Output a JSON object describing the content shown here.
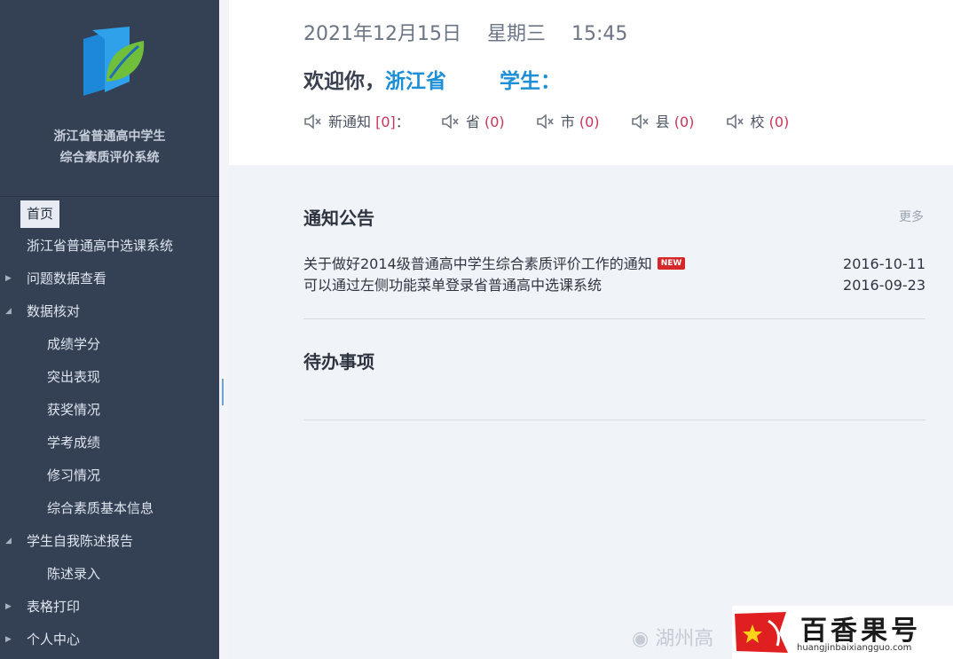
{
  "brand": {
    "title_line1": "浙江省普通高中学生",
    "title_line2": "综合素质评价系统"
  },
  "nav": {
    "items": [
      {
        "label": "首页"
      },
      {
        "label": "浙江省普通高中选课系统"
      },
      {
        "label": "问题数据查看",
        "expander": "collapsed"
      },
      {
        "label": "数据核对",
        "expander": "expanded"
      },
      {
        "label": "成绩学分"
      },
      {
        "label": "突出表现"
      },
      {
        "label": "获奖情况"
      },
      {
        "label": "学考成绩"
      },
      {
        "label": "修习情况"
      },
      {
        "label": "综合素质基本信息"
      },
      {
        "label": "学生自我陈述报告",
        "expander": "expanded"
      },
      {
        "label": "陈述录入"
      },
      {
        "label": "表格打印",
        "expander": "collapsed"
      },
      {
        "label": "个人中心",
        "expander": "collapsed"
      }
    ]
  },
  "header": {
    "date": "2021年12月15日",
    "weekday": "星期三",
    "time": "15:45",
    "welcome_prefix": "欢迎你，",
    "welcome_org": "浙江省",
    "welcome_role": "学生：",
    "notifications": {
      "new_label": "新通知",
      "new_count": "[0]",
      "colon": "：",
      "province_label": "省",
      "province_count": "(0)",
      "city_label": "市",
      "city_count": "(0)",
      "county_label": "县",
      "county_count": "(0)",
      "school_label": "校",
      "school_count": "(0)"
    }
  },
  "notices": {
    "title": "通知公告",
    "more": "更多",
    "items": [
      {
        "title": "关于做好2014级普通高中学生综合素质评价工作的通知",
        "badge": "NEW",
        "date": "2016-10-11"
      },
      {
        "title": "可以通过左侧功能菜单登录省普通高中选课系统",
        "date": "2016-09-23"
      }
    ]
  },
  "todo": {
    "title": "待办事项"
  },
  "watermark": {
    "weibo_text": "湖州高",
    "site_name": "百香果号",
    "site_url": "huangjinbaixiangguo.com"
  },
  "colors": {
    "sidebar_bg": "#344054",
    "accent_blue": "#1d8fd6",
    "count_red": "#c8355a",
    "content_bg": "#f0f3f8"
  }
}
